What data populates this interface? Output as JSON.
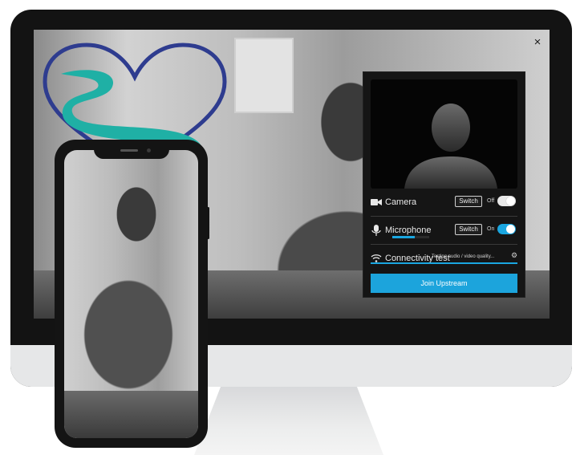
{
  "colors": {
    "accent": "#1ca4dc",
    "panel_bg": "#151515",
    "logo_heart": "#2e3c8f",
    "logo_stream": "#1fb0a5"
  },
  "monitor": {
    "close_icon": "×"
  },
  "panel": {
    "camera": {
      "label": "Camera",
      "switch_label": "Switch",
      "state": "Off",
      "toggle_on": false
    },
    "microphone": {
      "label": "Microphone",
      "switch_label": "Switch",
      "state": "On",
      "toggle_on": true,
      "level": 0.6
    },
    "connectivity": {
      "label": "Connectivity test",
      "status": "Testing audio / video quality..."
    },
    "join_button": "Join Upstream"
  },
  "icons": [
    "heart-logo",
    "close-icon",
    "avatar-silhouette-icon",
    "video-camera-icon",
    "microphone-icon",
    "wifi-icon",
    "gear-icon"
  ]
}
